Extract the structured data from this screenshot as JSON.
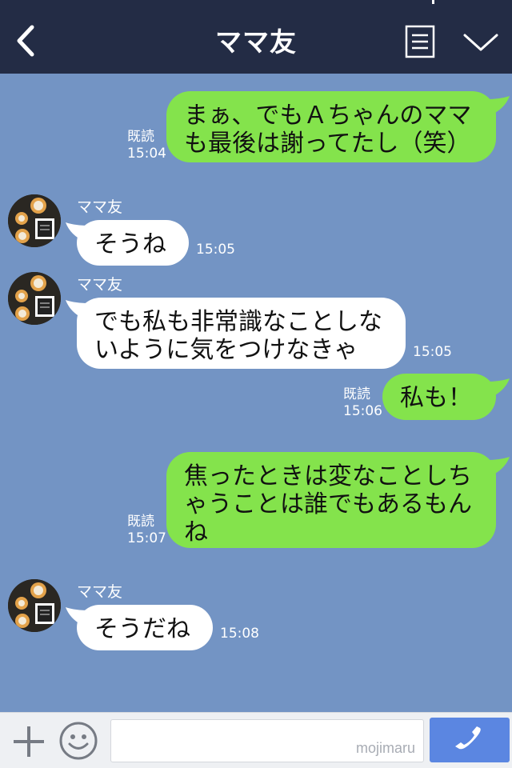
{
  "header": {
    "title": "ママ友"
  },
  "messages": [
    {
      "type": "sent",
      "text": "まぁ、でもＡちゃんのママ\nも最後は謝ってたし（笑）",
      "read": "既読",
      "time": "15:04"
    },
    {
      "type": "received",
      "sender": "ママ友",
      "text": "そうね",
      "time": "15:05"
    },
    {
      "type": "received",
      "sender": "ママ友",
      "text": "でも私も非常識なことしな\nいように気をつけなきゃ",
      "time": "15:05"
    },
    {
      "type": "sent",
      "text": "私も！",
      "read": "既読",
      "time": "15:06"
    },
    {
      "type": "sent",
      "text": "焦ったときは変なことしち\nゃうことは誰でもあるもん\nね",
      "read": "既読",
      "time": "15:07"
    },
    {
      "type": "received",
      "sender": "ママ友",
      "text": "そうだね",
      "time": "15:08"
    }
  ],
  "footer": {
    "input_value": "",
    "watermark": "mojimaru"
  },
  "colors": {
    "header_bg": "#232c45",
    "chat_bg": "#7394c4",
    "sent_bubble": "#84e34c",
    "received_bubble": "#ffffff",
    "call_button": "#5b86e1"
  },
  "icons": {
    "back": "chevron-left-icon",
    "menu": "list-icon",
    "collapse": "chevron-down-icon",
    "add": "plus-icon",
    "emoji": "smiley-icon",
    "call": "phone-icon"
  }
}
